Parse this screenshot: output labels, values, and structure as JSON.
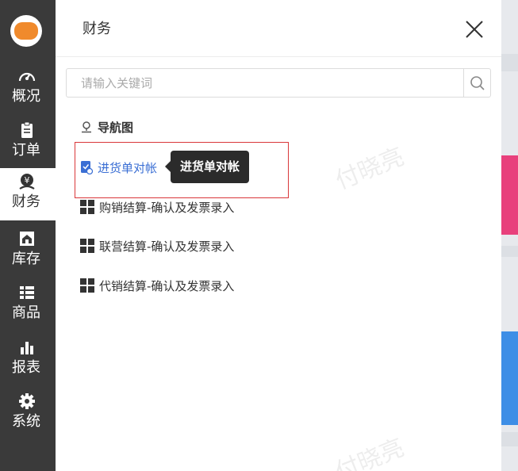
{
  "sidebar": {
    "items": [
      {
        "label": "概况",
        "icon": "dashboard-icon"
      },
      {
        "label": "订单",
        "icon": "clipboard-icon"
      },
      {
        "label": "财务",
        "icon": "finance-icon"
      },
      {
        "label": "库存",
        "icon": "warehouse-icon"
      },
      {
        "label": "商品",
        "icon": "list-icon"
      },
      {
        "label": "报表",
        "icon": "bar-chart-icon"
      },
      {
        "label": "系统",
        "icon": "gear-icon"
      }
    ],
    "active_index": 2
  },
  "drawer": {
    "title": "财务",
    "search_placeholder": "请输入关键词",
    "section_title": "导航图",
    "items": [
      {
        "label": "进货单对帐",
        "icon": "document-check-icon",
        "highlighted": true
      },
      {
        "label": "购销结算-确认及发票录入",
        "icon": "grid-icon"
      },
      {
        "label": "联营结算-确认及发票录入",
        "icon": "grid-icon"
      },
      {
        "label": "代销结算-确认及发票录入",
        "icon": "grid-icon"
      }
    ],
    "tooltip": "进货单对帐"
  },
  "watermark": "付晓亮",
  "colors": {
    "sidebar_bg": "#3a3a3a",
    "highlight_link": "#3b6fd4",
    "highlight_border": "#d9373a",
    "tooltip_bg": "#2b2b2b",
    "backdrop_pink": "#e8407c",
    "backdrop_blue": "#3e8ee6"
  }
}
